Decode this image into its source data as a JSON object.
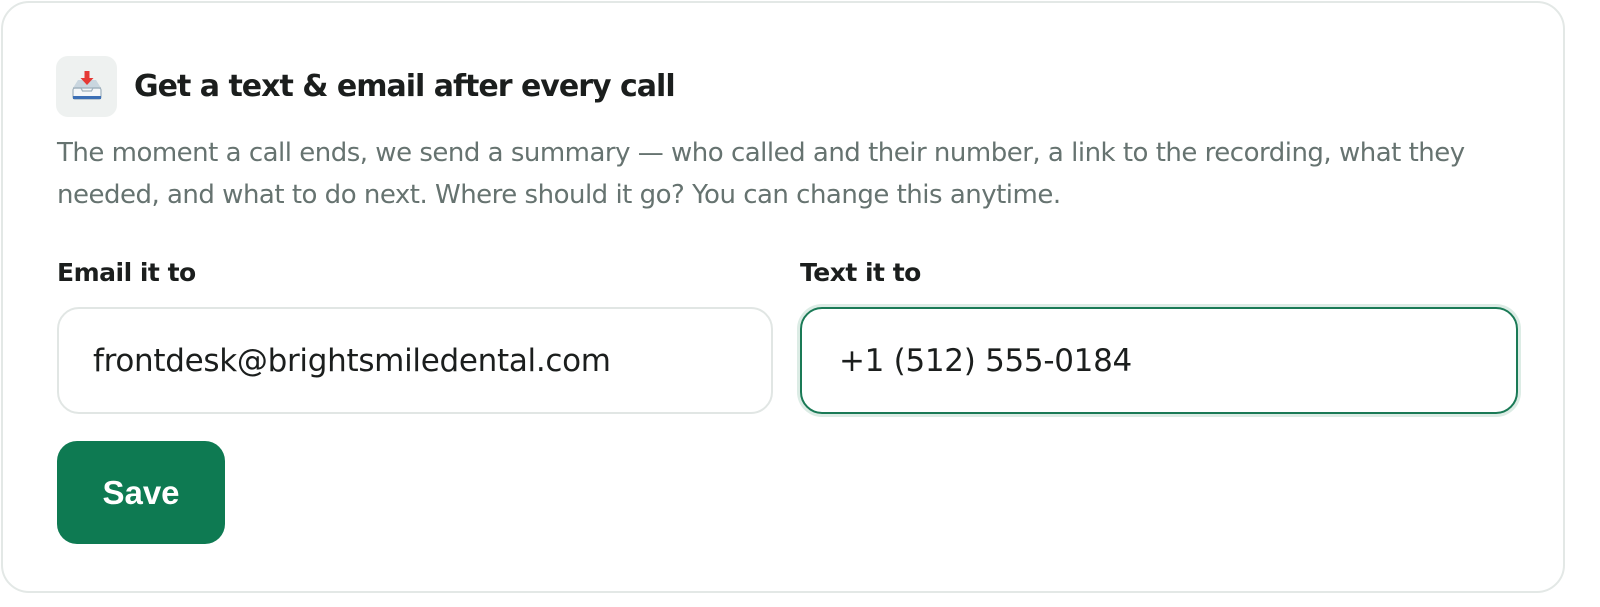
{
  "card": {
    "icon": "inbox-tray-icon",
    "title": "Get a text & email after every call",
    "description": "The moment a call ends, we send a summary — who called and their number, a link to the recording, what they needed, and what to do next. Where should it go? You can change this anytime."
  },
  "email": {
    "label": "Email it to",
    "value": "frontdesk@brightsmiledental.com"
  },
  "text": {
    "label": "Text it to",
    "value": "+1 (512) 555-0184"
  },
  "save_label": "Save",
  "colors": {
    "accent": "#0e7a52",
    "focus_border": "#1a7a56",
    "muted_text": "#667370",
    "border": "#e3e8e6"
  }
}
